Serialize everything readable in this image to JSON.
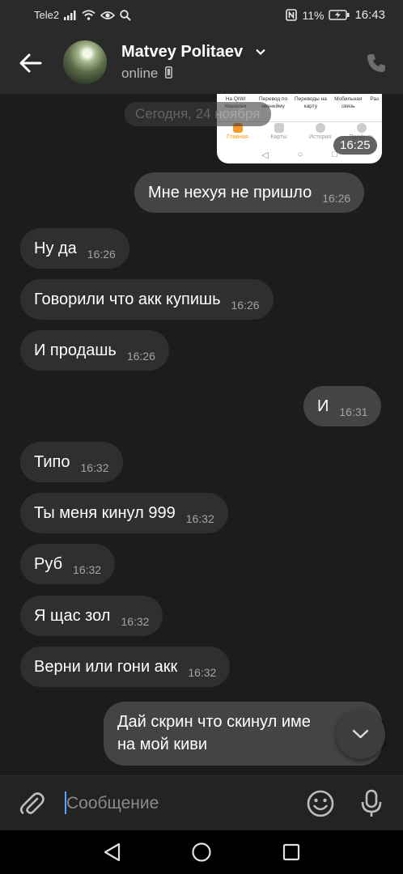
{
  "status_bar": {
    "carrier": "Tele2",
    "battery": "11%",
    "time": "16:43"
  },
  "header": {
    "contact_name": "Matvey Politaev",
    "status": "online"
  },
  "screenshot_preview": {
    "menu": [
      "На QIWI Кошелек",
      "Перевод по никнейму",
      "Переводы на карту",
      "Мобильная связь",
      "Раз"
    ],
    "tabs": [
      "Главная",
      "Карты",
      "История",
      "Профиль"
    ],
    "time": "16:25"
  },
  "date_divider": "Сегодня, 24 ноября",
  "messages": [
    {
      "text": "Мне нехуя не пришло",
      "time": "16:26",
      "dir": "out"
    },
    {
      "text": "Ну да",
      "time": "16:26",
      "dir": "in"
    },
    {
      "text": "Говорили что акк купишь",
      "time": "16:26",
      "dir": "in"
    },
    {
      "text": "И продашь",
      "time": "16:26",
      "dir": "in"
    },
    {
      "text": "И",
      "time": "16:31",
      "dir": "out"
    },
    {
      "text": "Типо",
      "time": "16:32",
      "dir": "in"
    },
    {
      "text": "Ты меня кинул 999",
      "time": "16:32",
      "dir": "in"
    },
    {
      "text": "Руб",
      "time": "16:32",
      "dir": "in"
    },
    {
      "text": "Я щас зол",
      "time": "16:32",
      "dir": "in"
    },
    {
      "text": "Верни или гони акк",
      "time": "16:32",
      "dir": "in"
    }
  ],
  "last_message": {
    "line1": "Дай скрин что скинул име",
    "line2": "на мой киви"
  },
  "composer": {
    "placeholder": "Сообщение"
  },
  "icons": {
    "back": "arrow-left-icon",
    "phone": "phone-icon",
    "attach": "paperclip-icon",
    "emoji": "smiley-icon",
    "mic": "microphone-icon",
    "scroll": "chevron-down-icon"
  },
  "colors": {
    "background": "#1c1c1d",
    "bar": "#2a2a2b",
    "incoming_bubble": "#2f2f31",
    "outgoing_bubble": "#444446",
    "qiwi_accent": "#f39a2a"
  }
}
